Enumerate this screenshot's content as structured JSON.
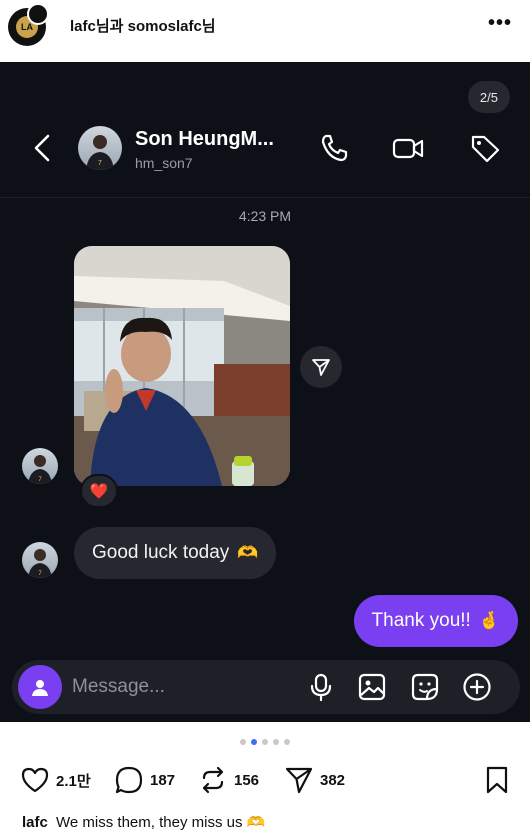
{
  "post": {
    "author_label": "lafc님과 somoslafc님",
    "more_label": "•••",
    "likes": "2.1만",
    "comments": "187",
    "reposts": "156",
    "shares": "382",
    "caption_user": "lafc",
    "caption_text": "We miss them, they miss us 🫶"
  },
  "dm": {
    "page_indicator": "2/5",
    "contact_name": "Son HeungM...",
    "contact_handle": "hm_son7",
    "timestamp": "4:23 PM",
    "reaction": "❤️",
    "incoming_message": "Good luck today",
    "incoming_emoji": "🫶",
    "outgoing_message": "Thank you!!",
    "outgoing_emoji": "🤞",
    "composer_placeholder": "Message..."
  },
  "carousel": {
    "count": 5,
    "active_index": 1
  },
  "colors": {
    "dm_background": "#0e1018",
    "bubble_incoming": "#26282f",
    "bubble_outgoing": "#7b3ff2",
    "accent_dot": "#3b6ff5",
    "like_reaction": "#e0243a"
  },
  "icons": {
    "header": [
      "back-arrow-icon",
      "phone-icon",
      "video-camera-icon",
      "tag-icon"
    ],
    "composer": [
      "camera-icon",
      "microphone-icon",
      "image-icon",
      "sticker-icon",
      "plus-icon"
    ],
    "post_actions": [
      "heart-icon",
      "comment-icon",
      "repost-icon",
      "share-icon",
      "bookmark-icon"
    ]
  }
}
